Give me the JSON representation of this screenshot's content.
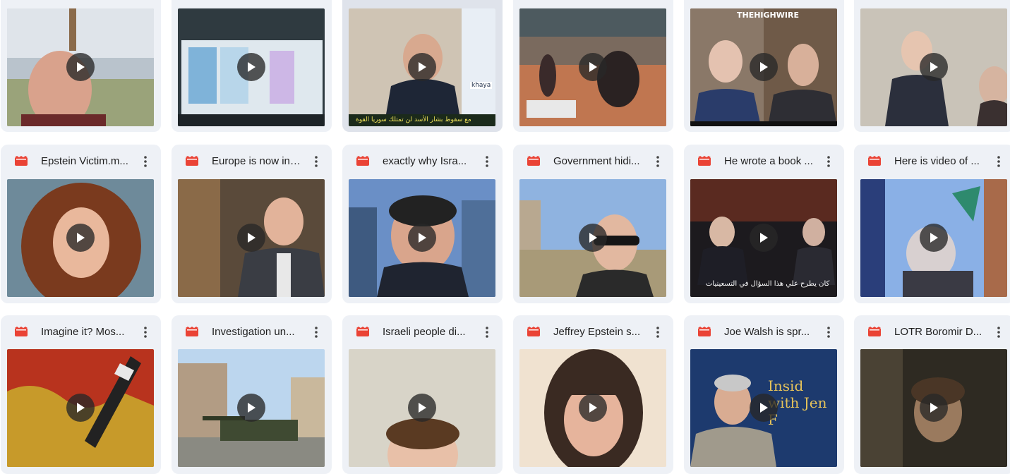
{
  "icons": {
    "file": "video-file-icon",
    "more": "more-vert-icon",
    "play": "play-icon"
  },
  "colors": {
    "card_bg": "#eef1f6",
    "file_icon": "#ea4335",
    "play_bg": "#282828"
  },
  "rows": [
    {
      "items": [
        {
          "title": "",
          "thumb_overlay": ""
        },
        {
          "title": "",
          "thumb_overlay": ""
        },
        {
          "title": "",
          "thumb_overlay": "مع سقوط بشار الأسد لن تمتلك سوريا القوة",
          "thumb_tag": "khaya"
        },
        {
          "title": "",
          "thumb_overlay": ""
        },
        {
          "title": "",
          "thumb_overlay": "THEHIGHWIRE"
        },
        {
          "title": "",
          "thumb_overlay": ""
        }
      ]
    },
    {
      "items": [
        {
          "title": "Epstein Victim.m...",
          "thumb_overlay": ""
        },
        {
          "title": "Europe is now in ...",
          "thumb_overlay": ""
        },
        {
          "title": "exactly why Isra...",
          "thumb_overlay": ""
        },
        {
          "title": "Government hidi...",
          "thumb_overlay": ""
        },
        {
          "title": "He wrote a book ...",
          "thumb_overlay": "كان يطرح علي هذا السؤال في التسعينيات"
        },
        {
          "title": "Here is video of ...",
          "thumb_overlay": ""
        }
      ]
    },
    {
      "items": [
        {
          "title": "Imagine it? Mos...",
          "thumb_overlay": ""
        },
        {
          "title": "Investigation un...",
          "thumb_overlay": ""
        },
        {
          "title": "Israeli people di...",
          "thumb_overlay": ""
        },
        {
          "title": "Jeffrey Epstein s...",
          "thumb_overlay": ""
        },
        {
          "title": "Joe Walsh is spr...",
          "thumb_overlay": "Insid with Jen F"
        },
        {
          "title": "LOTR Boromir D...",
          "thumb_overlay": ""
        }
      ]
    }
  ]
}
